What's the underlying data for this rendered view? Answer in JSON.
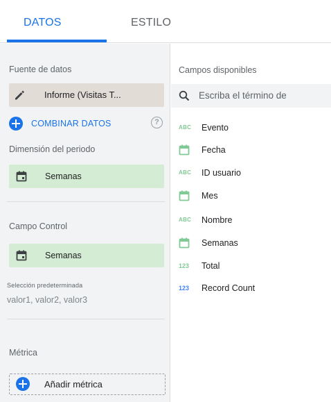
{
  "tabs": {
    "datos": "DATOS",
    "estilo": "ESTILO"
  },
  "left_panel": {
    "data_source_label": "Fuente de datos",
    "data_source_value": "Informe (Visitas T...",
    "combine_label": "COMBINAR DATOS",
    "help_glyph": "?",
    "period_dimension_label": "Dimensión del periodo",
    "period_dimension_value": "Semanas",
    "control_field_label": "Campo Control",
    "control_field_value": "Semanas",
    "default_selection_label": "Selección predeterminada",
    "default_selection_value": "valor1, valor2, valor3",
    "metric_label": "Métrica",
    "add_metric_label": "Añadir métrica"
  },
  "right_panel": {
    "title": "Campos disponibles",
    "search_placeholder": "Escriba el término de",
    "fields": [
      {
        "type_badge": "ABC",
        "icon": "text-type-icon",
        "label": "Evento"
      },
      {
        "type_badge": "",
        "icon": "calendar-icon",
        "label": "Fecha"
      },
      {
        "type_badge": "ABC",
        "icon": "text-type-icon",
        "label": "ID usuario"
      },
      {
        "type_badge": "",
        "icon": "calendar-icon",
        "label": "Mes"
      },
      {
        "type_badge": "ABC",
        "icon": "text-type-icon",
        "label": "Nombre"
      },
      {
        "type_badge": "",
        "icon": "calendar-icon",
        "label": "Semanas"
      },
      {
        "type_badge": "123",
        "icon": "number-type-icon",
        "label": "Total"
      },
      {
        "type_badge": "123",
        "icon": "number-type-icon",
        "label": "Record Count"
      }
    ]
  },
  "colors": {
    "accent_blue": "#1a73e8",
    "dimension_green": "#d4ecd3",
    "source_chip": "#e2dcd6",
    "panel_gray": "#f1f3f4"
  }
}
